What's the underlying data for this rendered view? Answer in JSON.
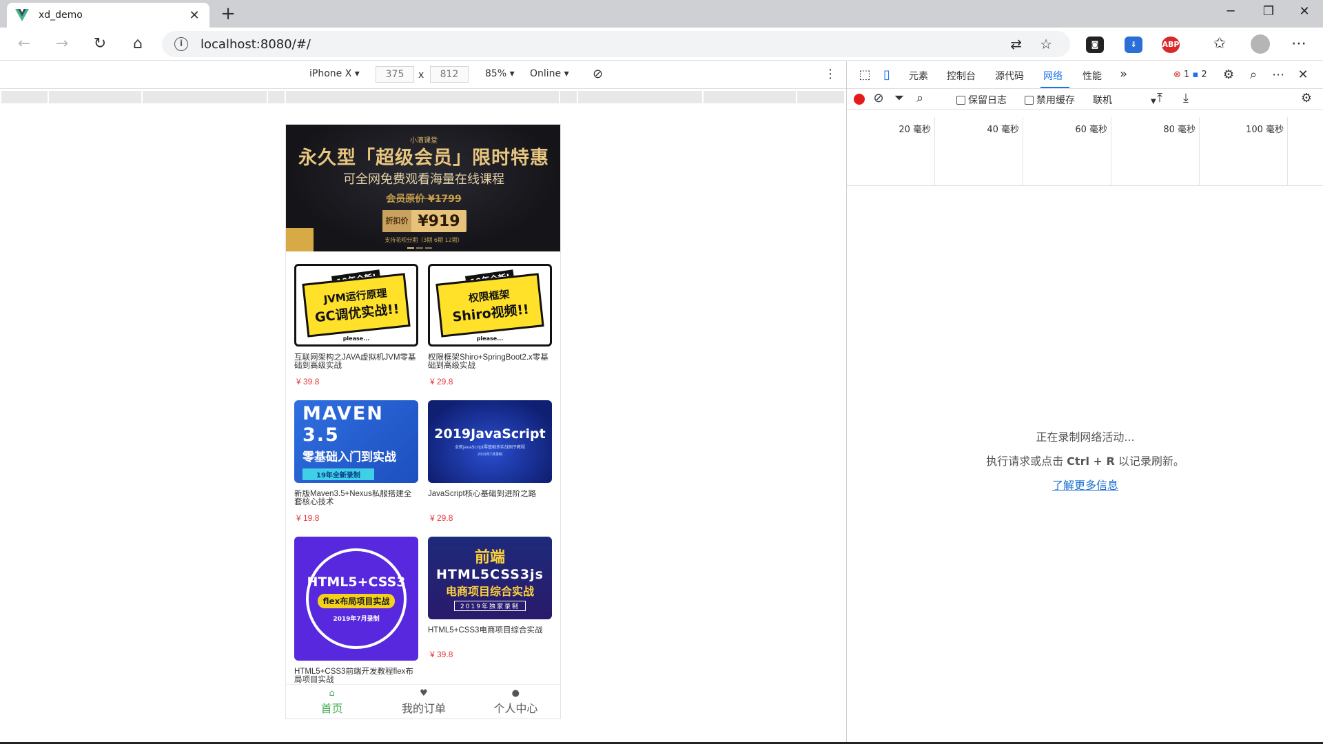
{
  "browser": {
    "tab_title": "xd_demo",
    "url": "localhost:8080/#/",
    "new_tab_label": "+",
    "tab_close_label": "✕"
  },
  "device_toolbar": {
    "device": "iPhone X ▾",
    "width": "375",
    "times": "x",
    "height": "812",
    "zoom": "85% ▾",
    "throttle": "Online ▾"
  },
  "phone": {
    "banner": {
      "small": "小滴课堂",
      "title": "永久型「超级会员」限时特惠",
      "subtitle": "可全网免费观看海量在线课程",
      "original_price": "会员原价 ¥1799",
      "discount_label": "折扣价",
      "discount_price": "¥919",
      "note": "支持花呗分期（3期 6期 12期）"
    },
    "cards": [
      {
        "thumb_tag": "19年全新!",
        "thumb_line1": "JVM运行原理",
        "thumb_line2": "GC调优实战!!",
        "thumb_please": "please...",
        "title": "互联网架构之JAVA虚拟机JVM零基础到高级实战",
        "price": "¥ 39.8"
      },
      {
        "thumb_tag": "19年全新!",
        "thumb_line1": "权限框架",
        "thumb_line2": "Shiro视频!!",
        "thumb_please": "please...",
        "title": "权限框架Shiro+SpringBoot2.x零基础到高级实战",
        "price": "¥ 29.8"
      },
      {
        "thumb_line1": "MAVEN 3.5",
        "thumb_line2": "零基础入门到实战",
        "thumb_line3": "19年全新录制",
        "title": "新版Maven3.5+Nexus私服搭建全套核心技术",
        "price": "¥ 19.8"
      },
      {
        "thumb_line1": "2019JavaScript",
        "thumb_line2": "全新JavaScript零基础多实战例子教程",
        "thumb_line3": "2019年7月录制",
        "title": "JavaScript核心基础到进阶之路",
        "price": "¥ 29.8"
      },
      {
        "thumb_line1": "HTML5+CSS3",
        "thumb_line2": "flex布局项目实战",
        "thumb_line3": "2019年7月录制",
        "title": "HTML5+CSS3前端开发教程flex布局项目实战"
      },
      {
        "thumb_line1": "前端",
        "thumb_line2": "HTML5CSS3js",
        "thumb_line3": "电商项目综合实战",
        "thumb_line4": "2019年独家录制",
        "title": "HTML5+CSS3电商项目综合实战",
        "price": "¥ 39.8"
      }
    ],
    "bottom_nav": [
      {
        "label": "首页",
        "icon": "home-icon",
        "active": true
      },
      {
        "label": "我的订单",
        "icon": "heart-icon",
        "active": false
      },
      {
        "label": "个人中心",
        "icon": "person-icon",
        "active": false
      }
    ]
  },
  "devtools": {
    "tabs": [
      "元素",
      "控制台",
      "源代码",
      "网络",
      "性能"
    ],
    "active_tab": "网络",
    "more_tabs": "»",
    "error_count": "1",
    "message_count": "2",
    "preserve_log": "保留日志",
    "disable_cache": "禁用缓存",
    "throttle": "联机",
    "timeline_labels": [
      "20 毫秒",
      "40 毫秒",
      "60 毫秒",
      "80 毫秒",
      "100 毫秒"
    ],
    "empty_line1": "正在录制网络活动...",
    "empty_line2_pre": "执行请求或点击 ",
    "empty_line2_key": "Ctrl + R",
    "empty_line2_post": " 以记录刷新。",
    "learn_more": "了解更多信息"
  },
  "colors": {
    "accent_blue": "#1a73e8",
    "price_red": "#e4393c",
    "nav_active_green": "#4cb05a"
  }
}
